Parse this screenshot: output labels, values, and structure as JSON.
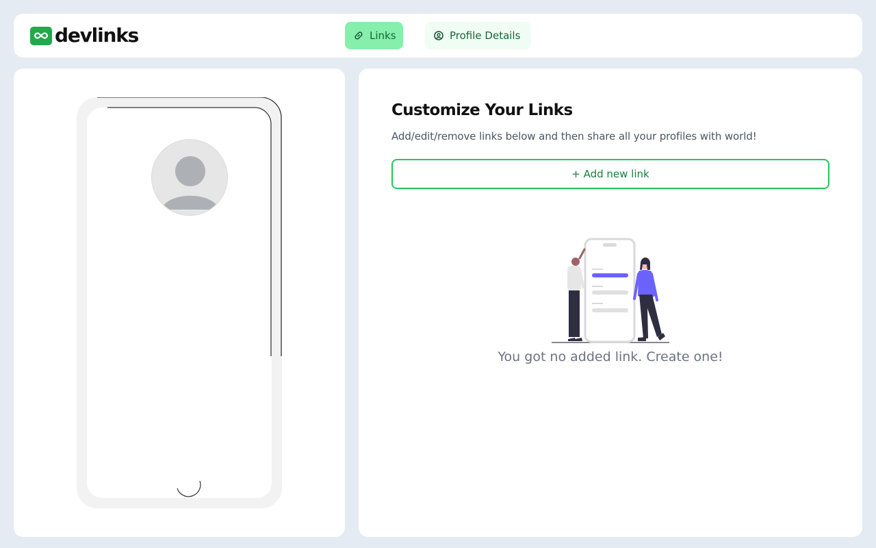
{
  "header": {
    "logo_text": "devlinks",
    "tabs": [
      {
        "label": "Links",
        "icon": "link-icon",
        "active": true
      },
      {
        "label": "Profile Details",
        "icon": "user-circle-icon",
        "active": false
      }
    ]
  },
  "main": {
    "title": "Customize Your Links",
    "subtitle": "Add/edit/remove links below and then share all your profiles with world!",
    "add_button_label": "+ Add new link",
    "empty_state": {
      "message": "You got no added link. Create one!",
      "illustration": "people-with-phone-illustration"
    }
  },
  "colors": {
    "accent": "#22c55e",
    "accent_dark": "#15803d",
    "tab_active_bg": "#86efac",
    "tab_inactive_bg": "#f0fdf4",
    "page_bg": "#e5ebf2",
    "illustration_purple": "#6c63ff"
  }
}
